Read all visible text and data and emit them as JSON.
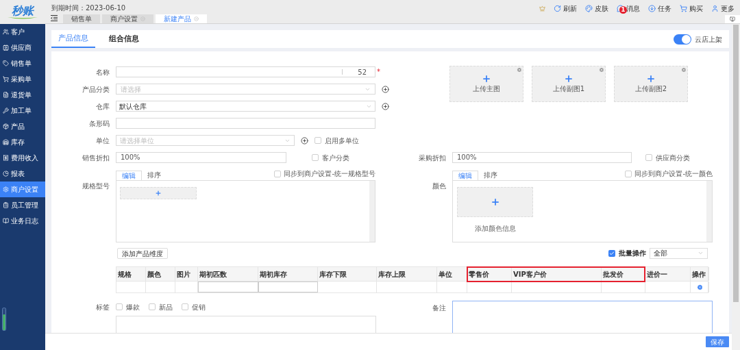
{
  "sidebar": {
    "logo": "秒账",
    "items": [
      {
        "label": "客户",
        "selected": false
      },
      {
        "label": "供应商",
        "selected": false
      },
      {
        "label": "销售单",
        "selected": false
      },
      {
        "label": "采购单",
        "selected": false
      },
      {
        "label": "退货单",
        "selected": false
      },
      {
        "label": "加工单",
        "selected": false
      },
      {
        "label": "产品",
        "selected": false
      },
      {
        "label": "库存",
        "selected": false
      },
      {
        "label": "费用收入",
        "selected": false
      },
      {
        "label": "报表",
        "selected": false
      },
      {
        "label": "商户设置",
        "selected": true
      },
      {
        "label": "员工管理",
        "selected": false
      },
      {
        "label": "业务日志",
        "selected": false
      }
    ]
  },
  "header": {
    "expiry": "到期时间：2023-06-10",
    "tabs": [
      {
        "label": "销售单",
        "selected": false,
        "closable": false
      },
      {
        "label": "商户设置",
        "selected": false,
        "closable": true
      },
      {
        "label": "新建产品",
        "selected": true,
        "closable": true
      }
    ],
    "actions": [
      {
        "label": "刷新",
        "kind": "refresh"
      },
      {
        "label": "皮肤",
        "kind": "skin"
      },
      {
        "label": "消息",
        "kind": "message",
        "badge": "1"
      },
      {
        "label": "任务",
        "kind": "task"
      },
      {
        "label": "购买",
        "kind": "cart"
      },
      {
        "label": "更多",
        "kind": "user"
      }
    ]
  },
  "page_tabs": [
    {
      "label": "产品信息",
      "selected": true
    },
    {
      "label": "组合信息",
      "selected": false
    }
  ],
  "cloud_toggle": {
    "label": "云店上架",
    "on": true
  },
  "form": {
    "name": {
      "label": "名称",
      "counter": "52",
      "required_mark": "*"
    },
    "category": {
      "label": "产品分类",
      "placeholder": "请选择"
    },
    "warehouse": {
      "label": "仓库",
      "value": "默认仓库"
    },
    "barcode": {
      "label": "条形码"
    },
    "unit": {
      "label": "单位",
      "placeholder": "请选择单位",
      "multi_unit": {
        "label": "启用多单位",
        "checked": false
      }
    },
    "uploads": [
      {
        "label": "上传主图"
      },
      {
        "label": "上传副图1"
      },
      {
        "label": "上传副图2"
      }
    ],
    "sale_discount": {
      "label": "销售折扣",
      "value": "100%",
      "option": {
        "label": "客户分类",
        "checked": false
      }
    },
    "purchase_discount": {
      "label": "采购折扣",
      "value": "100%",
      "option": {
        "label": "供应商分类",
        "checked": false
      }
    },
    "spec_panel": {
      "label": "规格型号",
      "tabs": [
        {
          "label": "编辑",
          "selected": true
        },
        {
          "label": "排序",
          "selected": false
        }
      ],
      "sync": {
        "label": "同步到商户设置-统一规格型号",
        "checked": false
      }
    },
    "color_panel": {
      "label": "颜色",
      "tabs": [
        {
          "label": "编辑",
          "selected": true
        },
        {
          "label": "排序",
          "selected": false
        }
      ],
      "sync": {
        "label": "同步到商户设置-统一颜色",
        "checked": false
      },
      "add_text": "添加颜色信息"
    },
    "add_dimension": "添加产品维度",
    "batch": {
      "label": "批量操作",
      "checked": true,
      "select": "全部"
    },
    "table": {
      "columns": [
        {
          "label": "规格",
          "kind": "text",
          "highlighted": false
        },
        {
          "label": "颜色",
          "kind": "text",
          "highlighted": false
        },
        {
          "label": "图片",
          "kind": "text",
          "highlighted": false
        },
        {
          "label": "期初匹数",
          "kind": "input",
          "highlighted": false
        },
        {
          "label": "期初库存",
          "kind": "input",
          "highlighted": false
        },
        {
          "label": "库存下限",
          "kind": "text",
          "highlighted": false
        },
        {
          "label": "库存上限",
          "kind": "text",
          "highlighted": false
        },
        {
          "label": "单位",
          "kind": "text",
          "highlighted": false
        },
        {
          "label": "零售价",
          "kind": "text",
          "highlighted": true
        },
        {
          "label": "VIP客户价",
          "kind": "text",
          "highlighted": true
        },
        {
          "label": "批发价",
          "kind": "text",
          "highlighted": true
        },
        {
          "label": "进价一",
          "kind": "text",
          "highlighted": false
        },
        {
          "label": "操作",
          "kind": "action",
          "highlighted": false
        }
      ]
    },
    "tags": {
      "label": "标签",
      "options": [
        {
          "label": "爆款",
          "checked": false
        },
        {
          "label": "新品",
          "checked": false
        },
        {
          "label": "促销",
          "checked": false
        }
      ]
    },
    "notes": {
      "label": "备注"
    },
    "save": "保存"
  }
}
